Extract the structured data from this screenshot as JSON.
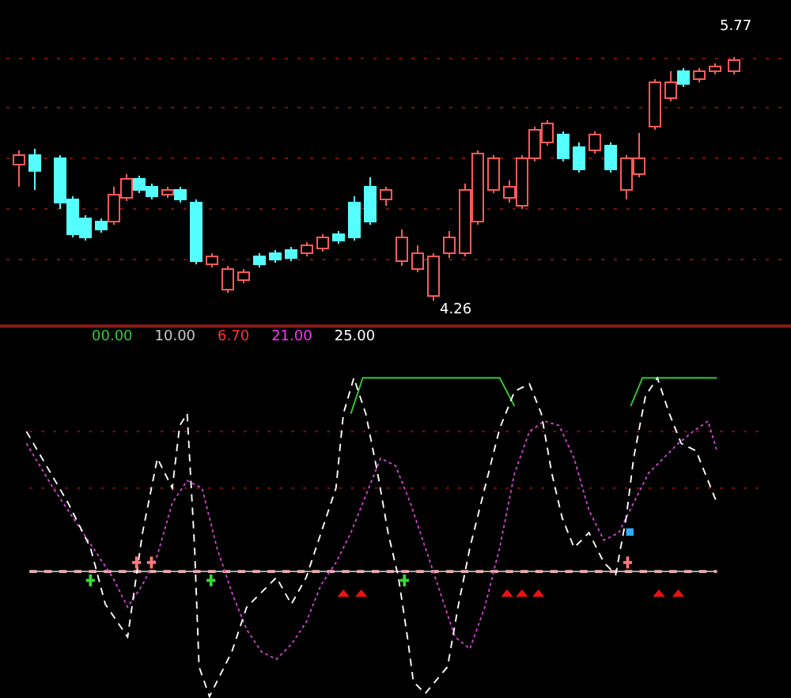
{
  "price_panel": {
    "high_label": "5.77",
    "low_label": "4.26"
  },
  "indicator_panel": {
    "readings": [
      {
        "text": "00.00",
        "color": "#33cc33"
      },
      {
        "text": "10.00",
        "color": "#cccccc"
      },
      {
        "text": "6.70",
        "color": "#ff3333"
      },
      {
        "text": "21.00",
        "color": "#ff33ff"
      },
      {
        "text": "25.00",
        "color": "#ffffff"
      }
    ]
  }
}
